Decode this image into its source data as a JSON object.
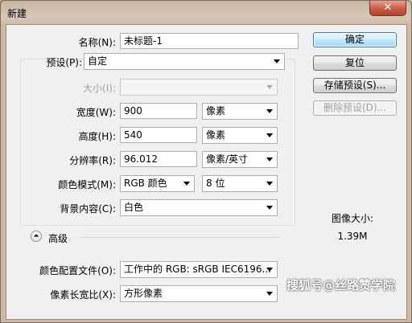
{
  "window": {
    "title": "新建",
    "close_glyph": "✕"
  },
  "form": {
    "name": {
      "label": "名称(N):",
      "value": "未标题-1"
    },
    "preset": {
      "label": "预设(P):",
      "value": "自定"
    },
    "size": {
      "label": "大小(I):",
      "value": ""
    },
    "width": {
      "label": "宽度(W):",
      "value": "900",
      "unit": "像素"
    },
    "height": {
      "label": "高度(H):",
      "value": "540",
      "unit": "像素"
    },
    "resolution": {
      "label": "分辨率(R):",
      "value": "96.012",
      "unit": "像素/英寸"
    },
    "color_mode": {
      "label": "颜色模式(M):",
      "value": "RGB 颜色",
      "depth": "8 位"
    },
    "background": {
      "label": "背景内容(C):",
      "value": "白色"
    },
    "advanced": {
      "label": "高级",
      "icon": "expand-icon",
      "glyph": "⏶"
    },
    "color_profile": {
      "label": "颜色配置文件(O):",
      "value": "工作中的 RGB: sRGB IEC6196..."
    },
    "pixel_aspect": {
      "label": "像素长宽比(X):",
      "value": "方形像素"
    }
  },
  "buttons": {
    "ok": "确定",
    "reset": "复位",
    "save_preset": "存储预设(S)...",
    "delete_preset": "删除预设(D)..."
  },
  "image_size": {
    "label": "图像大小:",
    "value": "1.39M"
  },
  "watermark": "搜狐号@丝路赞学院"
}
